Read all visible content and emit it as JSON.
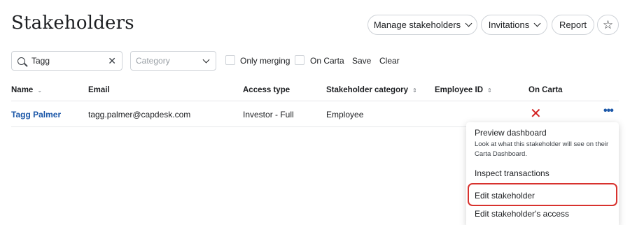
{
  "page": {
    "title": "Stakeholders"
  },
  "header_buttons": {
    "manage": "Manage stakeholders",
    "invitations": "Invitations",
    "report": "Report",
    "favorite_icon": "star-icon"
  },
  "filters": {
    "search_value": "Tagg",
    "category_placeholder": "Category",
    "only_merging": "Only merging",
    "on_carta": "On Carta",
    "save": "Save",
    "clear": "Clear"
  },
  "table": {
    "columns": [
      "Name",
      "Email",
      "Access type",
      "Stakeholder category",
      "Employee ID",
      "On Carta"
    ],
    "rows": [
      {
        "name": "Tagg Palmer",
        "email": "tagg.palmer@capdesk.com",
        "access_type": "Investor - Full",
        "category": "Employee",
        "employee_id": "",
        "on_carta": false
      }
    ]
  },
  "row_menu": {
    "items": [
      {
        "label": "Preview dashboard",
        "description": "Look at what this stakeholder will see on their Carta Dashboard."
      },
      {
        "label": "Inspect transactions"
      },
      {
        "label": "Edit stakeholder",
        "highlighted": true
      },
      {
        "label": "Edit stakeholder's access"
      }
    ],
    "highlight_color": "#d8322e"
  },
  "colors": {
    "link": "#1b57a8",
    "negative": "#d32020"
  }
}
